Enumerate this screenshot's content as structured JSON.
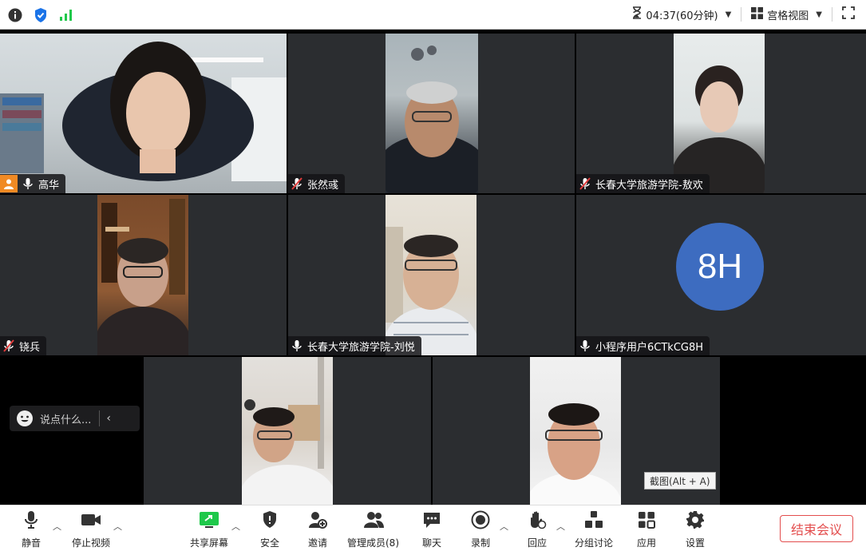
{
  "topbar": {
    "timer": "04:37(60分钟)",
    "view_mode": "宫格视图"
  },
  "participants": [
    {
      "name": "高华",
      "mic": "on",
      "active": true
    },
    {
      "name": "张然彧",
      "mic": "muted"
    },
    {
      "name": "长春大学旅游学院-敖欢",
      "mic": "muted"
    },
    {
      "name": "铙兵",
      "mic": "muted"
    },
    {
      "name": "长春大学旅游学院-刘悦",
      "mic": "on"
    },
    {
      "name": "小程序用户6CTkCG8H",
      "mic": "on",
      "avatar_text": "8H",
      "avatar_color": "#3d6cc0"
    }
  ],
  "chat": {
    "placeholder": "说点什么..."
  },
  "screenshot_tip": "截图(Alt + A)",
  "toolbar": {
    "mute": "静音",
    "stop_video": "停止视频",
    "share_screen": "共享屏幕",
    "security": "安全",
    "invite": "邀请",
    "manage_members": "管理成员(8)",
    "chat": "聊天",
    "record": "录制",
    "reaction": "回应",
    "breakout": "分组讨论",
    "apps": "应用",
    "settings": "设置",
    "end_meeting": "结束会议"
  },
  "colors": {
    "active_border": "#1ec84a",
    "end_button": "#e34d4d",
    "signal": "#1ec84a",
    "shield": "#1a73e8"
  }
}
